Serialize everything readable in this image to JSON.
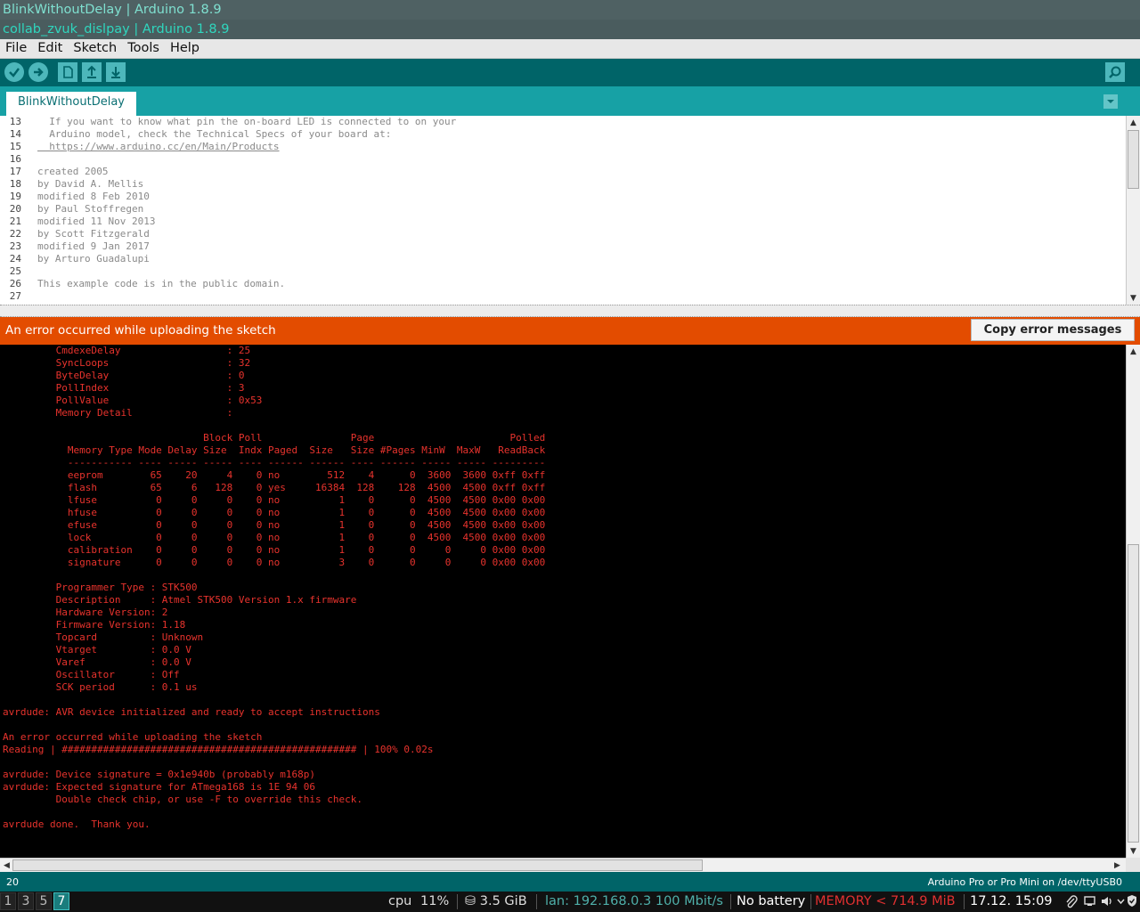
{
  "window": {
    "title_back": "BlinkWithoutDelay | Arduino 1.8.9",
    "title_front": "collab_zvuk_dislpay | Arduino 1.8.9"
  },
  "menu": [
    {
      "label": "File"
    },
    {
      "label": "Edit"
    },
    {
      "label": "Sketch"
    },
    {
      "label": "Tools"
    },
    {
      "label": "Help"
    }
  ],
  "toolbar": {
    "buttons": [
      "verify-icon",
      "upload-icon",
      "new-icon",
      "open-icon",
      "save-icon"
    ],
    "serial_monitor": "serial-monitor-icon"
  },
  "tab": {
    "active_label": "BlinkWithoutDelay"
  },
  "editor": {
    "lines": [
      {
        "n": "13",
        "text": "  If you want to know what pin the on-board LED is connected to on your"
      },
      {
        "n": "14",
        "text": "  Arduino model, check the Technical Specs of your board at:"
      },
      {
        "n": "15",
        "text": "  https://www.arduino.cc/en/Main/Products",
        "link": true
      },
      {
        "n": "16",
        "text": ""
      },
      {
        "n": "17",
        "text": "created 2005"
      },
      {
        "n": "18",
        "text": "by David A. Mellis"
      },
      {
        "n": "19",
        "text": "modified 8 Feb 2010"
      },
      {
        "n": "20",
        "text": "by Paul Stoffregen"
      },
      {
        "n": "21",
        "text": "modified 11 Nov 2013"
      },
      {
        "n": "22",
        "text": "by Scott Fitzgerald"
      },
      {
        "n": "23",
        "text": "modified 9 Jan 2017"
      },
      {
        "n": "24",
        "text": "by Arturo Guadalupi"
      },
      {
        "n": "25",
        "text": ""
      },
      {
        "n": "26",
        "text": "This example code is in the public domain."
      },
      {
        "n": "27",
        "text": ""
      }
    ]
  },
  "error_bar": {
    "message": "An error occurred while uploading the sketch",
    "copy_button": "Copy error messages"
  },
  "console": {
    "lines": [
      "         CmdexeDelay                  : 25",
      "         SyncLoops                    : 32",
      "         ByteDelay                    : 0",
      "         PollIndex                    : 3",
      "         PollValue                    : 0x53",
      "         Memory Detail                :",
      "",
      "                                  Block Poll               Page                       Polled",
      "           Memory Type Mode Delay Size  Indx Paged  Size   Size #Pages MinW  MaxW   ReadBack",
      "           ----------- ---- ----- ----- ---- ------ ------ ---- ------ ----- ----- ---------",
      "           eeprom        65    20     4    0 no        512    4      0  3600  3600 0xff 0xff",
      "           flash         65     6   128    0 yes     16384  128    128  4500  4500 0xff 0xff",
      "           lfuse          0     0     0    0 no          1    0      0  4500  4500 0x00 0x00",
      "           hfuse          0     0     0    0 no          1    0      0  4500  4500 0x00 0x00",
      "           efuse          0     0     0    0 no          1    0      0  4500  4500 0x00 0x00",
      "           lock           0     0     0    0 no          1    0      0  4500  4500 0x00 0x00",
      "           calibration    0     0     0    0 no          1    0      0     0     0 0x00 0x00",
      "           signature      0     0     0    0 no          3    0      0     0     0 0x00 0x00",
      "",
      "         Programmer Type : STK500",
      "         Description     : Atmel STK500 Version 1.x firmware",
      "         Hardware Version: 2",
      "         Firmware Version: 1.18",
      "         Topcard         : Unknown",
      "         Vtarget         : 0.0 V",
      "         Varef           : 0.0 V",
      "         Oscillator      : Off",
      "         SCK period      : 0.1 us",
      "",
      "avrdude: AVR device initialized and ready to accept instructions",
      "",
      "An error occurred while uploading the sketch",
      "Reading | ################################################## | 100% 0.02s",
      "",
      "avrdude: Device signature = 0x1e940b (probably m168p)",
      "avrdude: Expected signature for ATmega168 is 1E 94 06",
      "         Double check chip, or use -F to override this check.",
      "",
      "avrdude done.  Thank you.",
      ""
    ]
  },
  "status": {
    "line_number": "20",
    "board": "Arduino Pro or Pro Mini on /dev/ttyUSB0"
  },
  "i3bar": {
    "workspaces": [
      {
        "label": "1",
        "active": false
      },
      {
        "label": "3",
        "active": false
      },
      {
        "label": "5",
        "active": false
      },
      {
        "label": "7",
        "active": true
      }
    ],
    "cpu_label": "cpu",
    "cpu_value": "11%",
    "disk": "⛁ 3.5 GiB",
    "lan": "lan: 192.168.0.3 100 Mbit/s",
    "battery": "No battery",
    "memory": "MEMORY < 714.9 MiB",
    "datetime": "17.12. 15:09",
    "tray_icons": [
      "paperclip-icon",
      "window-icon",
      "volume-icon",
      "chevron-icon",
      "shield-icon"
    ]
  },
  "colors": {
    "teal_dark": "#006468",
    "teal_tab": "#17a1a5",
    "error_orange": "#e34c00",
    "console_text": "#e8332d",
    "lan_color": "#4fb0aa",
    "memory_color": "#e03030"
  }
}
